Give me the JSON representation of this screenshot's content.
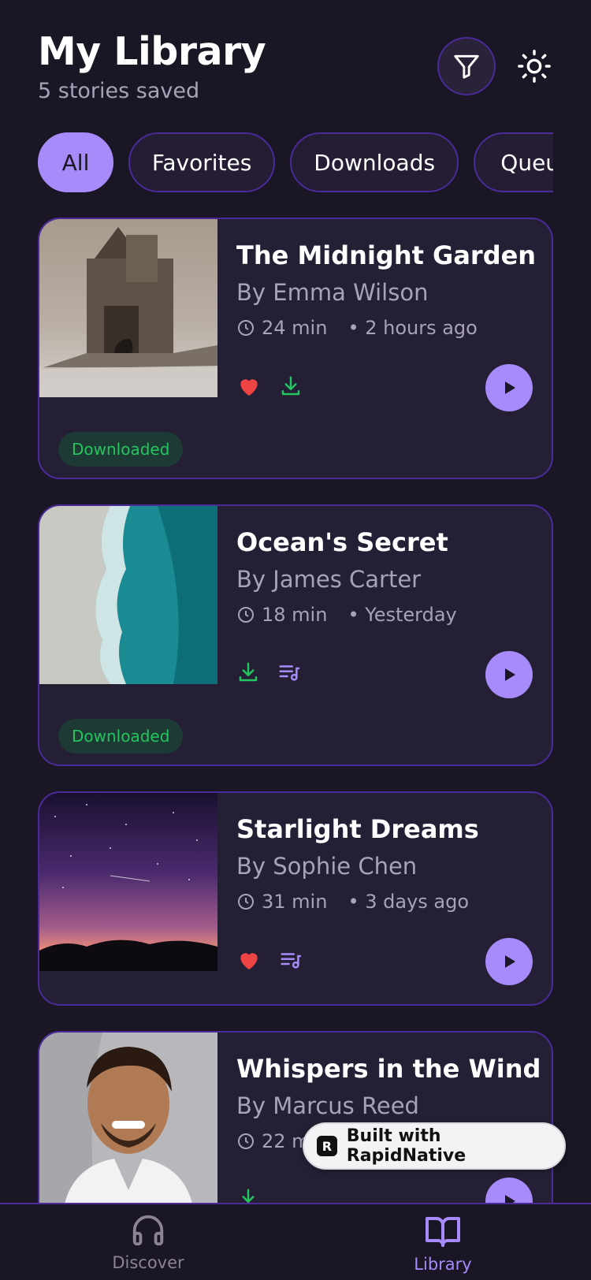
{
  "header": {
    "title": "My Library",
    "subtitle": "5 stories saved"
  },
  "chips": [
    "All",
    "Favorites",
    "Downloads",
    "Queue"
  ],
  "stories": [
    {
      "title": "The Midnight Garden",
      "author": "By Emma Wilson",
      "duration": "24 min",
      "ago": "• 2 hours ago",
      "badge": "Downloaded"
    },
    {
      "title": "Ocean's Secret",
      "author": "By James Carter",
      "duration": "18 min",
      "ago": "• Yesterday",
      "badge": "Downloaded"
    },
    {
      "title": "Starlight Dreams",
      "author": "By Sophie Chen",
      "duration": "31 min",
      "ago": "• 3 days ago"
    },
    {
      "title": "Whispers in the Wind",
      "author": "By Marcus Reed",
      "duration": "22 min",
      "ago": ""
    }
  ],
  "nav": {
    "discover": "Discover",
    "library": "Library"
  },
  "builtwith": {
    "logo": "R",
    "text": "Built with RapidNative"
  },
  "colors": {
    "accent": "#a78bfa",
    "heart": "#ef4444",
    "download": "#22c55e",
    "background": "#1a1625",
    "card": "#251f35",
    "border": "#4c2a9a"
  }
}
